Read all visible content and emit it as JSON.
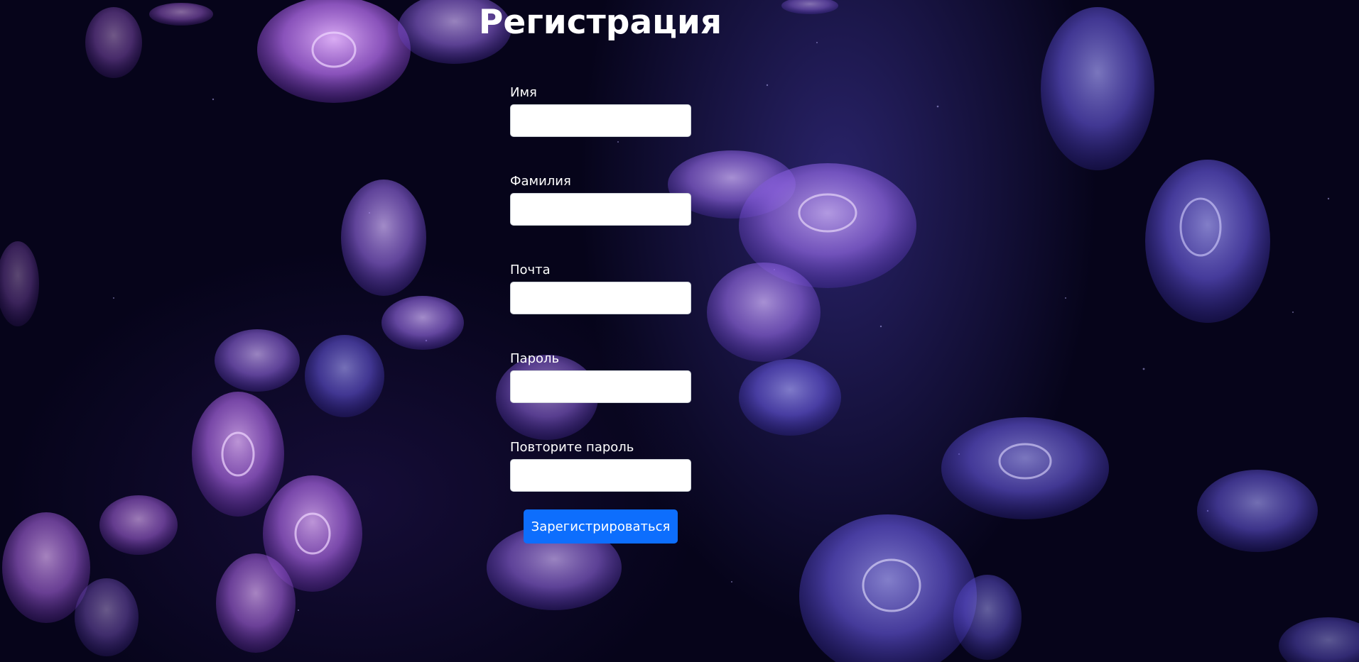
{
  "page": {
    "title": "Регистрация"
  },
  "form": {
    "fields": [
      {
        "label": "Имя",
        "value": "",
        "placeholder": ""
      },
      {
        "label": "Фамилия",
        "value": "",
        "placeholder": ""
      },
      {
        "label": "Почта",
        "value": "",
        "placeholder": ""
      },
      {
        "label": "Пароль",
        "value": "",
        "placeholder": ""
      },
      {
        "label": "Повторите пароль",
        "value": "",
        "placeholder": ""
      }
    ],
    "submit_label": "Зарегистрироваться"
  },
  "colors": {
    "background": "#06041a",
    "jellyfish": "#a77bf5",
    "button": "#0d6efd",
    "text": "#ffffff"
  }
}
